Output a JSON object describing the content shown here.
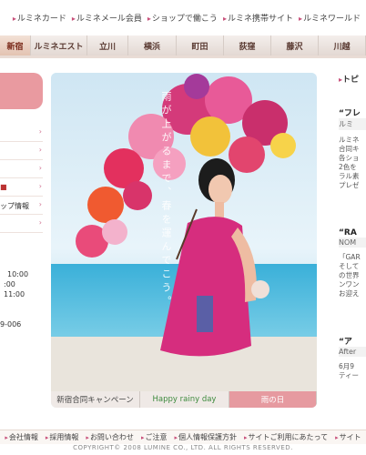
{
  "utility_links": [
    "ルミネカード",
    "ルミネメール会員",
    "ショップで働こう",
    "ルミネ携帯サイト",
    "ルミネワールド"
  ],
  "district_tabs": [
    "新宿",
    "ルミネエスト",
    "立川",
    "横浜",
    "町田",
    "荻窪",
    "藤沢",
    "川越"
  ],
  "active_tab": "新宿",
  "left_column": {
    "shop_info": "ップ情報",
    "hours": [
      "10:00",
      ":00",
      "11:00"
    ],
    "phone": "9-006"
  },
  "hero": {
    "vertical_copy": "雨が上がるまで、春を運んでこう。",
    "tabs": [
      "新宿合同キャンペーン",
      "Happy rainy day",
      "雨の日"
    ],
    "active_tab": "雨の日"
  },
  "right_column": {
    "heading": "トピ",
    "news": [
      {
        "title": "“フレ",
        "sub": "ルミ",
        "body": [
          "ルミネ",
          "合同キ",
          "各ショ",
          "2色を",
          "ラル素",
          "プレゼ"
        ]
      },
      {
        "title": "“RA",
        "sub": "NOM",
        "body": [
          "「GAR",
          "そして",
          "の世界",
          "ンワン",
          "お迎え"
        ]
      },
      {
        "title": "“ア",
        "sub": "After",
        "body": [
          "6月9",
          "ティー"
        ]
      }
    ]
  },
  "footer_links": [
    "会社情報",
    "採用情報",
    "お問い合わせ",
    "ご注意",
    "個人情報保護方針",
    "サイトご利用にあたって",
    "サイト"
  ],
  "copyright": "COPYRIGHT© 2008 LUMINE CO., LTD. ALL RIGHTS RESERVED.",
  "colors": {
    "accent_pink": "#e69aa0",
    "accent_arrow": "#c8507a",
    "tab_bg": "#e3d9d3"
  }
}
